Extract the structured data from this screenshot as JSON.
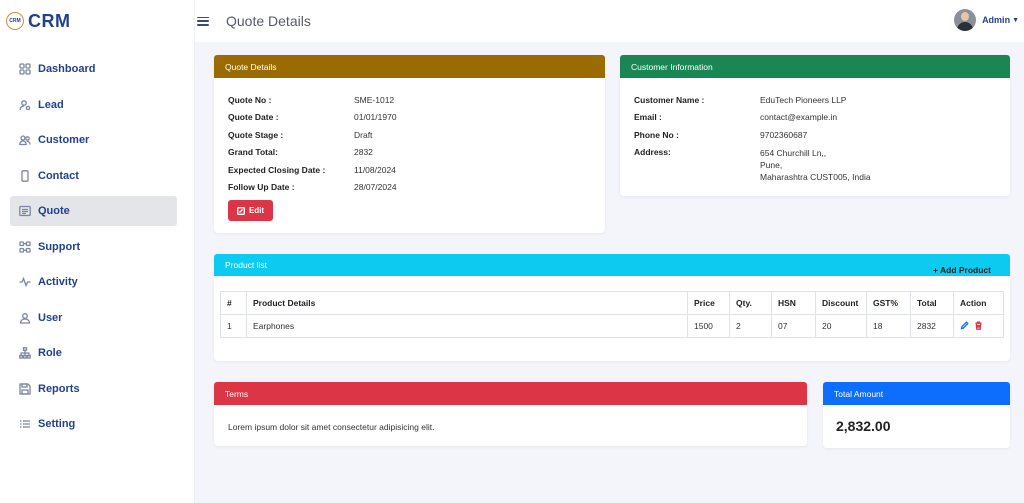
{
  "app": {
    "logo_mark": "CRM",
    "name": "CRM"
  },
  "sidebar": {
    "items": [
      {
        "label": "Dashboard",
        "icon": "grid-icon",
        "active": false
      },
      {
        "label": "Lead",
        "icon": "user-gear-icon",
        "active": false
      },
      {
        "label": "Customer",
        "icon": "users-icon",
        "active": false
      },
      {
        "label": "Contact",
        "icon": "phone-icon",
        "active": false
      },
      {
        "label": "Quote",
        "icon": "list-icon",
        "active": true
      },
      {
        "label": "Support",
        "icon": "support-icon",
        "active": false
      },
      {
        "label": "Activity",
        "icon": "activity-icon",
        "active": false
      },
      {
        "label": "User",
        "icon": "user-icon",
        "active": false
      },
      {
        "label": "Role",
        "icon": "hierarchy-icon",
        "active": false
      },
      {
        "label": "Reports",
        "icon": "save-icon",
        "active": false
      },
      {
        "label": "Setting",
        "icon": "settings-list-icon",
        "active": false
      }
    ]
  },
  "header": {
    "title": "Quote Details",
    "user_name": "Admin"
  },
  "quote": {
    "title": "Quote Details",
    "fields": [
      {
        "label": "Quote No :",
        "value": "SME-1012"
      },
      {
        "label": "Quote Date :",
        "value": "01/01/1970"
      },
      {
        "label": "Quote Stage :",
        "value": "Draft"
      },
      {
        "label": "Grand Total:",
        "value": "2832"
      },
      {
        "label": "Expected Closing Date :",
        "value": "11/08/2024"
      },
      {
        "label": "Follow Up Date :",
        "value": "28/07/2024"
      }
    ],
    "edit_label": "Edit"
  },
  "customer": {
    "title": "Customer Information",
    "fields": [
      {
        "label": "Customer Name :",
        "value": "EduTech Pioneers LLP"
      },
      {
        "label": "Email :",
        "value": "contact@example.in"
      },
      {
        "label": "Phone No :",
        "value": "9702360687"
      }
    ],
    "address_label": "Address:",
    "address_lines": [
      "654 Churchill Ln,,",
      "Pune,",
      "Maharashtra CUST005, India"
    ]
  },
  "products": {
    "title": "Product list",
    "add_label": "+ Add Product",
    "columns": [
      "#",
      "Product Details",
      "Price",
      "Qty.",
      "HSN",
      "Discount",
      "GST%",
      "Total",
      "Action"
    ],
    "rows": [
      {
        "no": "1",
        "details": "Earphones",
        "price": "1500",
        "qty": "2",
        "hsn": "07",
        "discount": "20",
        "gst": "18",
        "total": "2832"
      }
    ]
  },
  "terms": {
    "title": "Terms",
    "text": "Lorem ipsum dolor sit amet consectetur adipisicing elit."
  },
  "total": {
    "title": "Total Amount",
    "value": "2,832.00"
  },
  "colors": {
    "quote_header": "#9a6b00",
    "customer_header": "#198754",
    "product_header": "#0dcaf0",
    "terms_header": "#dc3545",
    "total_header": "#0d6efd",
    "brand": "#23408e",
    "edit_button": "#dc3545"
  }
}
